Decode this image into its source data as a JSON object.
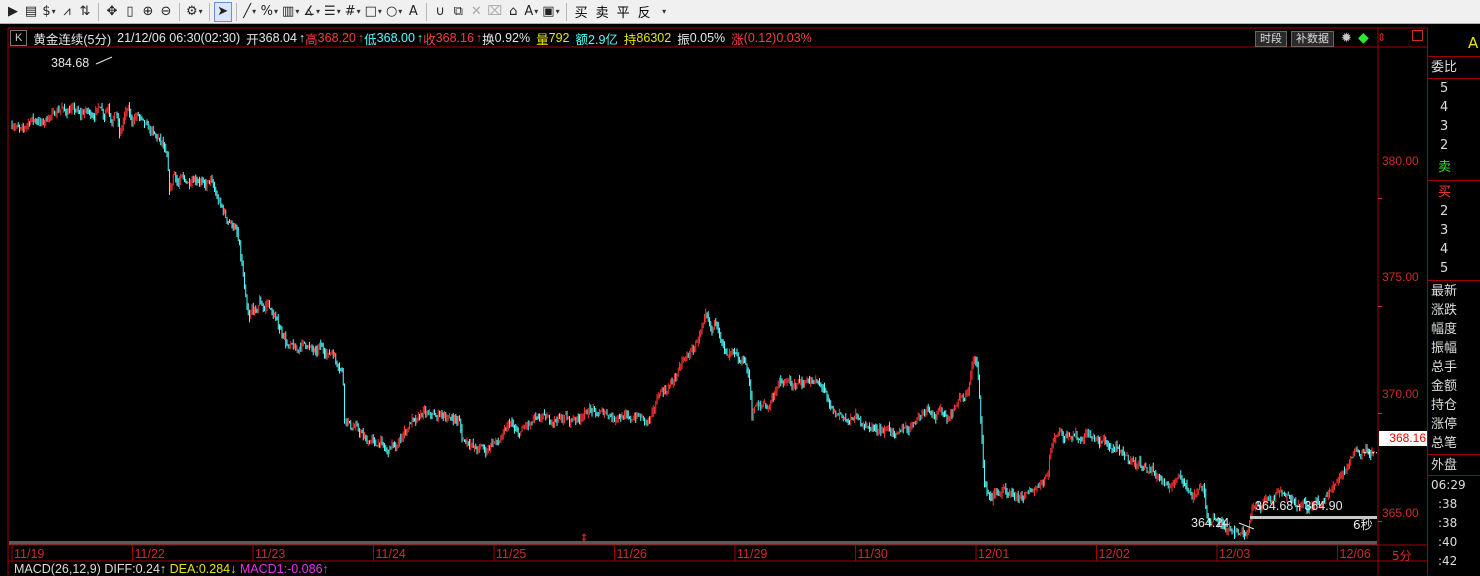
{
  "toolbar": {
    "items": [
      {
        "name": "play-icon",
        "glyph": "▶"
      },
      {
        "name": "document-icon",
        "glyph": "▤"
      },
      {
        "name": "dollar-icon",
        "glyph": "$",
        "caret": true
      },
      {
        "name": "filter-icon",
        "glyph": "⩘"
      },
      {
        "name": "chart-switch-icon",
        "glyph": "⇅"
      },
      {
        "sep": true
      },
      {
        "name": "move-icon",
        "glyph": "✥"
      },
      {
        "name": "vertical-bar-icon",
        "glyph": "▯"
      },
      {
        "name": "zoom-in-icon",
        "glyph": "⊕"
      },
      {
        "name": "zoom-out-icon",
        "glyph": "⊖"
      },
      {
        "sep": true
      },
      {
        "name": "gear-icon",
        "glyph": "⚙",
        "caret": true
      },
      {
        "sep": true
      },
      {
        "name": "cursor-icon",
        "glyph": "➤",
        "active": true
      },
      {
        "sep": true
      },
      {
        "name": "line-tool-icon",
        "glyph": "╱",
        "caret": true
      },
      {
        "name": "percent-tool-icon",
        "glyph": "%",
        "caret": true
      },
      {
        "name": "ruler-tool-icon",
        "glyph": "▥",
        "caret": true
      },
      {
        "name": "angle-tool-icon",
        "glyph": "∡",
        "caret": true
      },
      {
        "name": "level-tool-icon",
        "glyph": "☰",
        "caret": true
      },
      {
        "name": "grid-tool-icon",
        "glyph": "#",
        "caret": true
      },
      {
        "name": "rectangle-tool-icon",
        "glyph": "□",
        "caret": true
      },
      {
        "name": "circle-tool-icon",
        "glyph": "○",
        "caret": true
      },
      {
        "name": "text-tool-icon",
        "glyph": "A"
      },
      {
        "sep": true
      },
      {
        "name": "magnet-icon",
        "glyph": "∪"
      },
      {
        "name": "copy-icon",
        "glyph": "⧉"
      },
      {
        "name": "delete-icon",
        "glyph": "✕",
        "disabled": true
      },
      {
        "name": "trash-icon",
        "glyph": "⌧",
        "disabled": true
      },
      {
        "name": "lock-icon",
        "glyph": "⌂"
      },
      {
        "name": "font-color-icon",
        "glyph": "A",
        "caret": true
      },
      {
        "name": "save-icon",
        "glyph": "▣",
        "caret": true
      },
      {
        "sep": true
      }
    ],
    "trade_buttons": [
      {
        "name": "buy-button",
        "label": "买"
      },
      {
        "name": "sell-button",
        "label": "卖"
      },
      {
        "name": "close-position-button",
        "label": "平"
      },
      {
        "name": "reverse-button",
        "label": "反"
      }
    ]
  },
  "infobar": {
    "k_label": "K",
    "name": "黄金连续(5分)",
    "datetime": "21/12/06 06:30(02:30)",
    "open_label": "开",
    "open": "368.04",
    "high_label": "高",
    "high": "368.20",
    "low_label": "低",
    "low": "368.00",
    "close_label": "收",
    "close": "368.16",
    "arrow": "↑",
    "turnover_label": "换",
    "turnover": "0.92%",
    "volume_label": "量",
    "volume": "792",
    "amount_label": "额",
    "amount": "2.9亿",
    "oi_label": "持",
    "oi": "86302",
    "amplitude_label": "振",
    "amplitude": "0.05%",
    "change_label": "涨",
    "change": "(0.12)0.03%",
    "btn_period": "时段",
    "btn_data": "补数据"
  },
  "chart_data": {
    "type": "candlestick",
    "interval": "5分",
    "x_tick_labels": [
      "11/19",
      "11/22",
      "11/23",
      "11/24",
      "11/25",
      "11/26",
      "11/29",
      "11/30",
      "12/01",
      "12/02",
      "12/03",
      "12/06"
    ],
    "y_tick_labels": [
      "380.00",
      "375.00",
      "370.00",
      "365.00"
    ],
    "ylim": [
      364.1,
      387.0
    ],
    "last_price": "368.16",
    "annotations": {
      "high": "384.68",
      "low": "364.24",
      "range": "364.68 - 364.90",
      "countdown": "6秒"
    },
    "close_path": [
      [
        0,
        383.4
      ],
      [
        10,
        383.2
      ],
      [
        20,
        383.7
      ],
      [
        30,
        383.5
      ],
      [
        40,
        383.9
      ],
      [
        50,
        384.2
      ],
      [
        55,
        384.0
      ],
      [
        62,
        384.2
      ],
      [
        68,
        383.9
      ],
      [
        75,
        384.1
      ],
      [
        82,
        383.8
      ],
      [
        88,
        384.4
      ],
      [
        92,
        383.8
      ],
      [
        96,
        384.3
      ],
      [
        100,
        383.5
      ],
      [
        104,
        384.1
      ],
      [
        108,
        382.9
      ],
      [
        112,
        383.8
      ],
      [
        116,
        384.2
      ],
      [
        120,
        383.6
      ],
      [
        126,
        383.9
      ],
      [
        132,
        383.5
      ],
      [
        138,
        383.2
      ],
      [
        144,
        382.9
      ],
      [
        150,
        382.6
      ],
      [
        155,
        381.9
      ],
      [
        158,
        380.2
      ],
      [
        162,
        381.3
      ],
      [
        166,
        380.6
      ],
      [
        170,
        381.0
      ],
      [
        176,
        380.7
      ],
      [
        182,
        380.9
      ],
      [
        188,
        380.8
      ],
      [
        194,
        380.6
      ],
      [
        198,
        380.9
      ],
      [
        202,
        380.5
      ],
      [
        205,
        380.0
      ],
      [
        210,
        379.6
      ],
      [
        215,
        379.0
      ],
      [
        220,
        378.8
      ],
      [
        225,
        378.4
      ],
      [
        228,
        377.6
      ],
      [
        231,
        376.5
      ],
      [
        234,
        375.2
      ],
      [
        237,
        374.3
      ],
      [
        240,
        374.9
      ],
      [
        244,
        374.7
      ],
      [
        248,
        375.3
      ],
      [
        252,
        374.8
      ],
      [
        256,
        375.2
      ],
      [
        260,
        374.6
      ],
      [
        264,
        374.4
      ],
      [
        268,
        373.9
      ],
      [
        272,
        373.6
      ],
      [
        276,
        373.0
      ],
      [
        280,
        373.2
      ],
      [
        284,
        372.9
      ],
      [
        288,
        373.1
      ],
      [
        292,
        373.3
      ],
      [
        296,
        373.1
      ],
      [
        300,
        373.0
      ],
      [
        304,
        372.8
      ],
      [
        308,
        373.2
      ],
      [
        312,
        372.9
      ],
      [
        316,
        372.7
      ],
      [
        320,
        372.9
      ],
      [
        324,
        372.4
      ],
      [
        328,
        372.1
      ],
      [
        331,
        371.9
      ],
      [
        332,
        369.8
      ],
      [
        336,
        369.6
      ],
      [
        340,
        369.3
      ],
      [
        344,
        369.4
      ],
      [
        348,
        369.1
      ],
      [
        352,
        368.9
      ],
      [
        356,
        368.6
      ],
      [
        360,
        368.8
      ],
      [
        364,
        368.5
      ],
      [
        368,
        368.7
      ],
      [
        372,
        368.4
      ],
      [
        376,
        368.2
      ],
      [
        380,
        368.6
      ],
      [
        384,
        368.3
      ],
      [
        388,
        368.8
      ],
      [
        392,
        369.1
      ],
      [
        396,
        369.3
      ],
      [
        400,
        369.7
      ],
      [
        404,
        369.6
      ],
      [
        408,
        369.9
      ],
      [
        412,
        370.1
      ],
      [
        416,
        369.9
      ],
      [
        420,
        370.0
      ],
      [
        424,
        369.8
      ],
      [
        428,
        370.0
      ],
      [
        432,
        369.9
      ],
      [
        436,
        369.7
      ],
      [
        440,
        369.8
      ],
      [
        444,
        369.7
      ],
      [
        448,
        369.6
      ],
      [
        450,
        368.8
      ],
      [
        454,
        368.7
      ],
      [
        458,
        368.6
      ],
      [
        462,
        368.4
      ],
      [
        466,
        368.3
      ],
      [
        470,
        368.5
      ],
      [
        474,
        368.2
      ],
      [
        478,
        368.5
      ],
      [
        482,
        368.7
      ],
      [
        486,
        368.6
      ],
      [
        490,
        368.9
      ],
      [
        494,
        369.3
      ],
      [
        498,
        369.6
      ],
      [
        502,
        369.3
      ],
      [
        506,
        369.0
      ],
      [
        510,
        369.2
      ],
      [
        514,
        369.5
      ],
      [
        518,
        369.4
      ],
      [
        522,
        369.8
      ],
      [
        526,
        369.7
      ],
      [
        530,
        369.9
      ],
      [
        534,
        369.8
      ],
      [
        538,
        369.7
      ],
      [
        542,
        369.6
      ],
      [
        546,
        369.8
      ],
      [
        550,
        369.7
      ],
      [
        554,
        369.9
      ],
      [
        558,
        369.6
      ],
      [
        562,
        369.8
      ],
      [
        566,
        369.7
      ],
      [
        570,
        369.9
      ],
      [
        574,
        370.0
      ],
      [
        578,
        370.2
      ],
      [
        582,
        370.1
      ],
      [
        586,
        369.9
      ],
      [
        590,
        370.1
      ],
      [
        594,
        370.0
      ],
      [
        598,
        369.9
      ],
      [
        602,
        369.7
      ],
      [
        606,
        369.9
      ],
      [
        610,
        369.8
      ],
      [
        614,
        369.9
      ],
      [
        618,
        369.7
      ],
      [
        622,
        369.8
      ],
      [
        626,
        369.9
      ],
      [
        630,
        369.8
      ],
      [
        634,
        369.6
      ],
      [
        638,
        369.7
      ],
      [
        642,
        370.2
      ],
      [
        646,
        370.8
      ],
      [
        650,
        371.1
      ],
      [
        654,
        371.0
      ],
      [
        658,
        371.3
      ],
      [
        662,
        371.6
      ],
      [
        666,
        371.9
      ],
      [
        670,
        372.4
      ],
      [
        674,
        372.6
      ],
      [
        678,
        372.8
      ],
      [
        682,
        373.0
      ],
      [
        686,
        373.5
      ],
      [
        690,
        373.9
      ],
      [
        694,
        374.6
      ],
      [
        697,
        374.2
      ],
      [
        700,
        373.8
      ],
      [
        704,
        374.4
      ],
      [
        708,
        373.6
      ],
      [
        712,
        373.0
      ],
      [
        716,
        372.6
      ],
      [
        720,
        372.9
      ],
      [
        724,
        372.7
      ],
      [
        728,
        372.3
      ],
      [
        732,
        372.6
      ],
      [
        736,
        371.8
      ],
      [
        738,
        371.4
      ],
      [
        740,
        369.9
      ],
      [
        744,
        370.4
      ],
      [
        748,
        370.3
      ],
      [
        752,
        370.5
      ],
      [
        756,
        370.2
      ],
      [
        760,
        370.7
      ],
      [
        764,
        371.1
      ],
      [
        768,
        371.5
      ],
      [
        772,
        371.3
      ],
      [
        776,
        371.6
      ],
      [
        780,
        371.2
      ],
      [
        784,
        371.4
      ],
      [
        788,
        371.5
      ],
      [
        792,
        371.3
      ],
      [
        796,
        371.6
      ],
      [
        800,
        371.4
      ],
      [
        804,
        371.5
      ],
      [
        808,
        371.3
      ],
      [
        812,
        371.2
      ],
      [
        816,
        370.5
      ],
      [
        820,
        370.2
      ],
      [
        824,
        369.9
      ],
      [
        828,
        370.0
      ],
      [
        832,
        369.8
      ],
      [
        836,
        369.6
      ],
      [
        840,
        369.7
      ],
      [
        844,
        369.9
      ],
      [
        848,
        369.6
      ],
      [
        852,
        369.5
      ],
      [
        856,
        369.3
      ],
      [
        860,
        369.4
      ],
      [
        864,
        369.2
      ],
      [
        868,
        369.3
      ],
      [
        872,
        369.1
      ],
      [
        876,
        369.4
      ],
      [
        880,
        369.1
      ],
      [
        884,
        368.9
      ],
      [
        888,
        369.2
      ],
      [
        892,
        369.4
      ],
      [
        896,
        369.2
      ],
      [
        900,
        369.5
      ],
      [
        904,
        369.7
      ],
      [
        908,
        369.9
      ],
      [
        912,
        370.1
      ],
      [
        916,
        370.3
      ],
      [
        920,
        370.0
      ],
      [
        924,
        369.8
      ],
      [
        928,
        370.2
      ],
      [
        932,
        370.0
      ],
      [
        936,
        369.7
      ],
      [
        940,
        370.0
      ],
      [
        944,
        370.4
      ],
      [
        948,
        370.8
      ],
      [
        952,
        370.6
      ],
      [
        956,
        371.0
      ],
      [
        960,
        372.2
      ],
      [
        963,
        372.6
      ],
      [
        966,
        371.9
      ],
      [
        968,
        370.4
      ],
      [
        970,
        368.9
      ],
      [
        972,
        366.8
      ],
      [
        976,
        366.3
      ],
      [
        980,
        366.0
      ],
      [
        984,
        366.4
      ],
      [
        988,
        366.2
      ],
      [
        992,
        366.5
      ],
      [
        996,
        366.1
      ],
      [
        1000,
        366.3
      ],
      [
        1004,
        366.0
      ],
      [
        1008,
        366.2
      ],
      [
        1012,
        366.1
      ],
      [
        1016,
        366.3
      ],
      [
        1020,
        366.4
      ],
      [
        1024,
        366.5
      ],
      [
        1028,
        366.7
      ],
      [
        1032,
        366.9
      ],
      [
        1036,
        367.2
      ],
      [
        1038,
        368.1
      ],
      [
        1040,
        368.5
      ],
      [
        1044,
        369.0
      ],
      [
        1048,
        369.2
      ],
      [
        1052,
        368.8
      ],
      [
        1056,
        369.1
      ],
      [
        1060,
        368.9
      ],
      [
        1064,
        369.0
      ],
      [
        1068,
        368.7
      ],
      [
        1072,
        368.9
      ],
      [
        1076,
        369.1
      ],
      [
        1080,
        368.8
      ],
      [
        1084,
        368.9
      ],
      [
        1088,
        368.6
      ],
      [
        1092,
        368.8
      ],
      [
        1096,
        368.5
      ],
      [
        1100,
        368.3
      ],
      [
        1104,
        368.4
      ],
      [
        1108,
        368.2
      ],
      [
        1112,
        368.1
      ],
      [
        1116,
        367.9
      ],
      [
        1120,
        367.8
      ],
      [
        1124,
        367.6
      ],
      [
        1128,
        367.7
      ],
      [
        1132,
        367.5
      ],
      [
        1136,
        367.3
      ],
      [
        1140,
        367.4
      ],
      [
        1144,
        367.1
      ],
      [
        1148,
        367.0
      ],
      [
        1152,
        366.7
      ],
      [
        1156,
        366.5
      ],
      [
        1160,
        366.7
      ],
      [
        1164,
        366.9
      ],
      [
        1168,
        367.2
      ],
      [
        1172,
        366.8
      ],
      [
        1176,
        366.4
      ],
      [
        1180,
        366.1
      ],
      [
        1184,
        366.3
      ],
      [
        1188,
        366.6
      ],
      [
        1192,
        366.5
      ],
      [
        1194,
        365.4
      ],
      [
        1198,
        364.9
      ],
      [
        1202,
        365.2
      ],
      [
        1206,
        364.8
      ],
      [
        1210,
        364.9
      ],
      [
        1214,
        364.6
      ],
      [
        1218,
        364.7
      ],
      [
        1222,
        364.5
      ],
      [
        1226,
        364.4
      ],
      [
        1230,
        364.5
      ],
      [
        1234,
        364.3
      ],
      [
        1240,
        365.5
      ],
      [
        1244,
        365.7
      ],
      [
        1248,
        365.6
      ],
      [
        1252,
        365.9
      ],
      [
        1256,
        366.1
      ],
      [
        1260,
        365.9
      ],
      [
        1264,
        366.2
      ],
      [
        1268,
        366.4
      ],
      [
        1272,
        366.1
      ],
      [
        1276,
        366.3
      ],
      [
        1280,
        366.0
      ],
      [
        1284,
        365.8
      ],
      [
        1288,
        365.6
      ],
      [
        1292,
        365.9
      ],
      [
        1296,
        365.5
      ],
      [
        1300,
        365.7
      ],
      [
        1304,
        366.0
      ],
      [
        1308,
        365.6
      ],
      [
        1312,
        366.0
      ],
      [
        1316,
        366.2
      ],
      [
        1320,
        366.5
      ],
      [
        1324,
        366.8
      ],
      [
        1328,
        367.1
      ],
      [
        1332,
        367.3
      ],
      [
        1336,
        367.6
      ],
      [
        1340,
        368.0
      ],
      [
        1344,
        368.3
      ],
      [
        1348,
        368.1
      ],
      [
        1352,
        368.4
      ],
      [
        1356,
        368.2
      ],
      [
        1360,
        368.1
      ],
      [
        1363,
        368.16
      ]
    ]
  },
  "macd": {
    "title": "MACD(26,12,9)",
    "diff": "DIFF:0.24↑",
    "dea": "DEA:0.284↓",
    "macd1": "MACD1:-0.086↑"
  },
  "right_panel": {
    "top_letter": "A",
    "ratio_label": "委比",
    "sell_levels": [
      "5",
      "4",
      "3",
      "2"
    ],
    "sell_label": "卖",
    "buy_label": "买",
    "buy_levels": [
      "2",
      "3",
      "4",
      "5"
    ],
    "fields": [
      "最新",
      "涨跌",
      "幅度",
      "振幅",
      "总手",
      "金额",
      "持仓",
      "涨停",
      "总笔"
    ],
    "outer_label": "外盘",
    "times": [
      "06:29",
      ":38",
      ":38",
      ":40",
      ":42"
    ]
  },
  "colors": {
    "up": "#ff3232",
    "down": "#54ffff",
    "axis_red": "#cc2b2b",
    "grid_red": "#a00000",
    "last_price_bg": "#ffffff",
    "last_price_fg": "#ff0000"
  }
}
